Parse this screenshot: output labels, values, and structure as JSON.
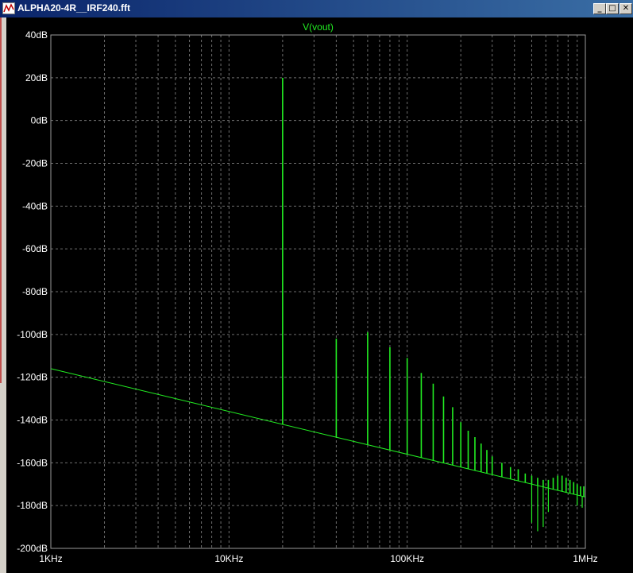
{
  "window": {
    "title": "ALPHA20-4R__IRF240.fft",
    "minimize_glyph": "_",
    "maximize_glyph": "□",
    "close_glyph": "✕"
  },
  "colors": {
    "trace": "#22ee22",
    "grid": "#6e6e6e",
    "frame": "#9a9a9a",
    "label": "#ffffff",
    "background": "#000000"
  },
  "chart_data": {
    "type": "line",
    "title": "V(vout)",
    "xlabel": "",
    "ylabel": "",
    "x_scale": "log",
    "xlim": [
      1000,
      1000000
    ],
    "ylim": [
      -200,
      40
    ],
    "grid": true,
    "x_ticks": [
      {
        "value": 1000,
        "label": "1KHz"
      },
      {
        "value": 10000,
        "label": "10KHz"
      },
      {
        "value": 100000,
        "label": "100KHz"
      },
      {
        "value": 1000000,
        "label": "1MHz"
      }
    ],
    "y_ticks": [
      {
        "value": 40,
        "label": "40dB"
      },
      {
        "value": 20,
        "label": "20dB"
      },
      {
        "value": 0,
        "label": "0dB"
      },
      {
        "value": -20,
        "label": "-20dB"
      },
      {
        "value": -40,
        "label": "-40dB"
      },
      {
        "value": -60,
        "label": "-60dB"
      },
      {
        "value": -80,
        "label": "-80dB"
      },
      {
        "value": -100,
        "label": "-100dB"
      },
      {
        "value": -120,
        "label": "-120dB"
      },
      {
        "value": -140,
        "label": "-140dB"
      },
      {
        "value": -160,
        "label": "-160dB"
      },
      {
        "value": -180,
        "label": "-180dB"
      },
      {
        "value": -200,
        "label": "-200dB"
      }
    ],
    "series": [
      {
        "name": "V(vout)",
        "noise_floor": [
          [
            1000,
            -116
          ],
          [
            1000000,
            -176
          ]
        ],
        "peaks": [
          {
            "f": 20000,
            "db": 20
          },
          {
            "f": 40000,
            "db": -102
          },
          {
            "f": 60000,
            "db": -99
          },
          {
            "f": 80000,
            "db": -106
          },
          {
            "f": 100000,
            "db": -111
          },
          {
            "f": 120000,
            "db": -118
          },
          {
            "f": 140000,
            "db": -123
          },
          {
            "f": 160000,
            "db": -129
          },
          {
            "f": 180000,
            "db": -134
          },
          {
            "f": 200000,
            "db": -141
          },
          {
            "f": 220000,
            "db": -145
          },
          {
            "f": 240000,
            "db": -148
          },
          {
            "f": 260000,
            "db": -151
          },
          {
            "f": 280000,
            "db": -154
          },
          {
            "f": 300000,
            "db": -157
          },
          {
            "f": 340000,
            "db": -160
          },
          {
            "f": 380000,
            "db": -162
          },
          {
            "f": 420000,
            "db": -163
          },
          {
            "f": 460000,
            "db": -165
          },
          {
            "f": 500000,
            "db": -166
          },
          {
            "f": 540000,
            "db": -167
          },
          {
            "f": 580000,
            "db": -168
          },
          {
            "f": 620000,
            "db": -168
          },
          {
            "f": 660000,
            "db": -167
          },
          {
            "f": 700000,
            "db": -166
          },
          {
            "f": 740000,
            "db": -166
          },
          {
            "f": 780000,
            "db": -167
          },
          {
            "f": 820000,
            "db": -168
          },
          {
            "f": 860000,
            "db": -169
          },
          {
            "f": 900000,
            "db": -170
          },
          {
            "f": 940000,
            "db": -171
          },
          {
            "f": 980000,
            "db": -171
          }
        ],
        "dips": [
          {
            "f": 500000,
            "db": -188
          },
          {
            "f": 540000,
            "db": -192
          },
          {
            "f": 580000,
            "db": -190
          },
          {
            "f": 620000,
            "db": -183
          },
          {
            "f": 900000,
            "db": -180
          },
          {
            "f": 960000,
            "db": -181
          }
        ]
      }
    ]
  }
}
